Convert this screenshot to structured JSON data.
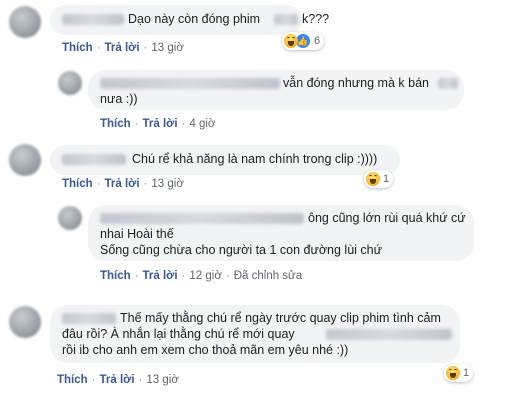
{
  "comments": [
    {
      "text_before": "Dạo này còn đóng phim",
      "text_after": "k???",
      "actions": {
        "like": "Thích",
        "reply": "Trả lời",
        "time": "13 giờ"
      },
      "reaction_count": "6",
      "reaction_icons": [
        "haha-icon",
        "like-icon"
      ]
    },
    {
      "line1": "vẫn đóng nhưng mà k bán",
      "line2": "nưa :))",
      "actions": {
        "like": "Thích",
        "reply": "Trả lời",
        "time": "4 giờ"
      }
    },
    {
      "text": "Chú rể khả năng là nam chính trong clip :))))",
      "actions": {
        "like": "Thích",
        "reply": "Trả lời",
        "time": "13 giờ"
      },
      "reaction_count": "1",
      "reaction_icons": [
        "haha-icon"
      ]
    },
    {
      "line1": "ông cũng lớn rùi quá khứ cứ",
      "line2": "nhai Hoài thế",
      "line3": "Sống cũng chừa cho người ta 1 con đường lùi chứ",
      "actions": {
        "like": "Thích",
        "reply": "Trả lời",
        "time": "12 giờ",
        "edited": "Đã chỉnh sửa"
      }
    },
    {
      "line1": "Thế mấy thằng chú rể ngày trước quay clip phim tình cảm",
      "line2": "đâu rồi? À nhắn lại thằng chú rể mới quay",
      "line3": "rồi ib cho anh em xem cho thoả mãn em yêu nhé :))",
      "actions": {
        "like": "Thích",
        "reply": "Trả lời",
        "time": "13 giờ"
      },
      "reaction_count": "1",
      "reaction_icons": [
        "haha-icon"
      ]
    }
  ]
}
